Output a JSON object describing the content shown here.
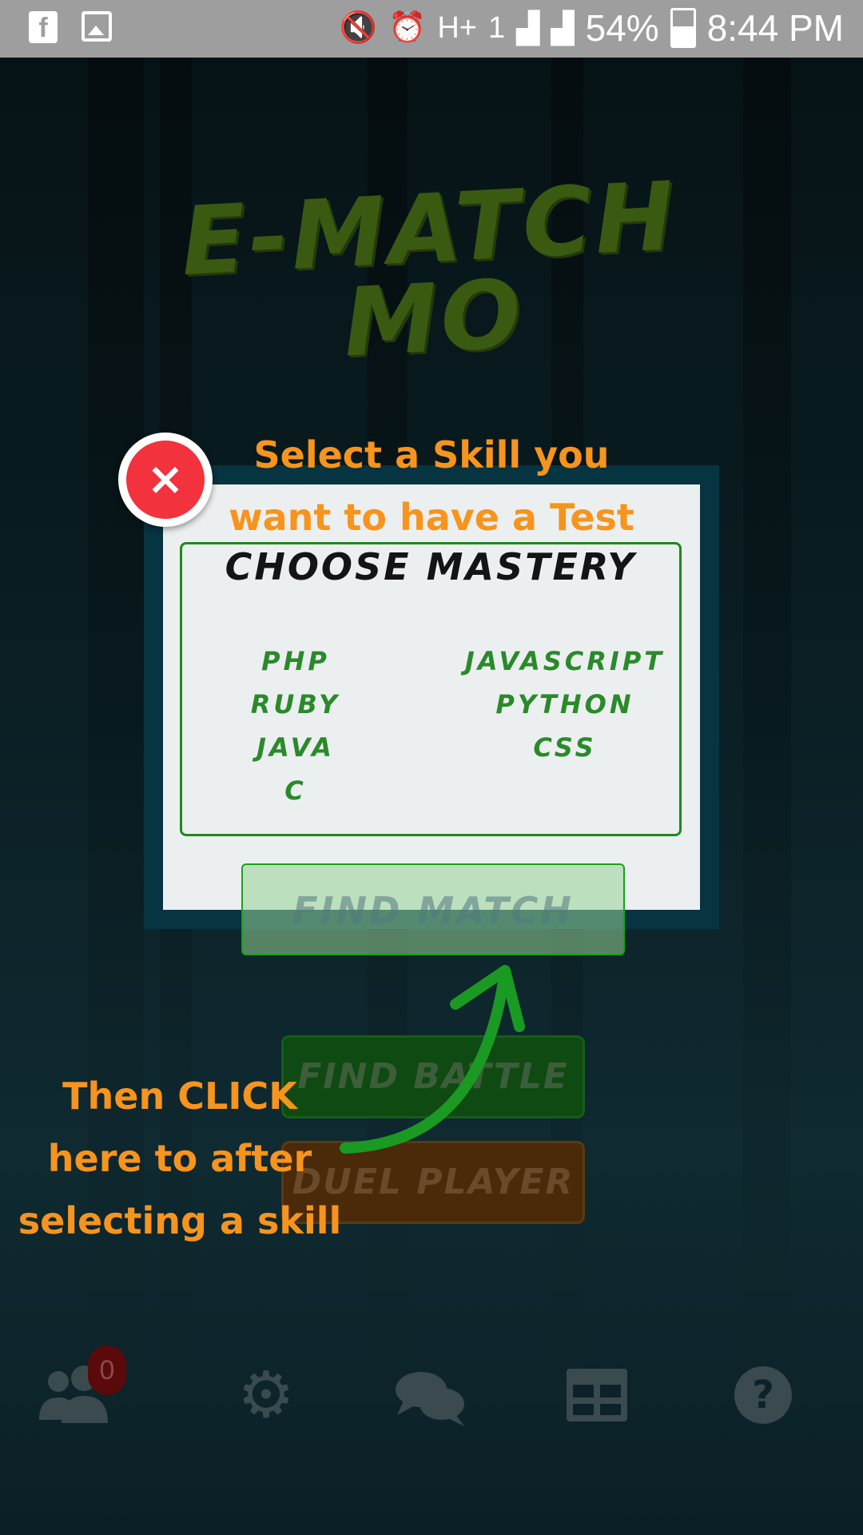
{
  "status_bar": {
    "battery": "54%",
    "time": "8:44 PM",
    "network": "H+",
    "sim": "1"
  },
  "app": {
    "title_line1": "E-MATCH",
    "title_line2": "MO"
  },
  "background_buttons": {
    "find_battle": "FIND BATTLE",
    "duel_player": "DUEL PLAYER"
  },
  "bottom_nav": {
    "friends_badge": "0"
  },
  "modal": {
    "heading": "CHOOSE MASTERY",
    "skills_left": [
      "PHP",
      "RUBY",
      "JAVA",
      "C"
    ],
    "skills_right": [
      "JAVASCRIPT",
      "PYTHON",
      "CSS"
    ],
    "find_match": "FIND MATCH",
    "close": "×"
  },
  "tutorial": {
    "top_line1": "Select a Skill you",
    "top_line2": "want to have a Test",
    "bottom_line1": "Then CLICK",
    "bottom_line2": "here to after",
    "bottom_line3": "selecting a skill"
  },
  "colors": {
    "accent_orange": "#f7941d",
    "skill_green": "#2a8a2a",
    "close_red": "#f2323c",
    "modal_frame": "#063440"
  }
}
